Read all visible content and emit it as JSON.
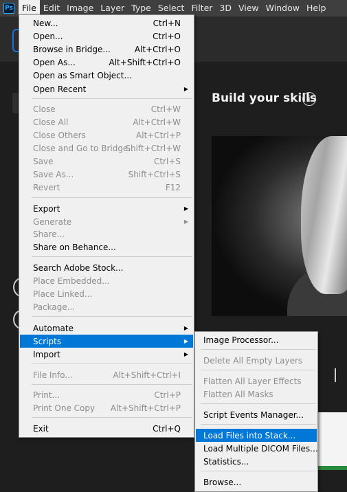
{
  "menubar": {
    "logo": "Ps",
    "items": [
      "File",
      "Edit",
      "Image",
      "Layer",
      "Type",
      "Select",
      "Filter",
      "3D",
      "View",
      "Window",
      "Help"
    ],
    "active": "File"
  },
  "background": {
    "heading": "Build your skills",
    "info_icon": "i"
  },
  "file_menu": [
    {
      "label": "New...",
      "shortcut": "Ctrl+N"
    },
    {
      "label": "Open...",
      "shortcut": "Ctrl+O"
    },
    {
      "label": "Browse in Bridge...",
      "shortcut": "Alt+Ctrl+O"
    },
    {
      "label": "Open As...",
      "shortcut": "Alt+Shift+Ctrl+O"
    },
    {
      "label": "Open as Smart Object...",
      "shortcut": ""
    },
    {
      "label": "Open Recent",
      "shortcut": "",
      "submenu": true
    },
    {
      "label": "Close",
      "shortcut": "Ctrl+W",
      "disabled": true
    },
    {
      "label": "Close All",
      "shortcut": "Alt+Ctrl+W",
      "disabled": true
    },
    {
      "label": "Close Others",
      "shortcut": "Alt+Ctrl+P",
      "disabled": true
    },
    {
      "label": "Close and Go to Bridge...",
      "shortcut": "Shift+Ctrl+W",
      "disabled": true
    },
    {
      "label": "Save",
      "shortcut": "Ctrl+S",
      "disabled": true
    },
    {
      "label": "Save As...",
      "shortcut": "Shift+Ctrl+S",
      "disabled": true
    },
    {
      "label": "Revert",
      "shortcut": "F12",
      "disabled": true
    },
    {
      "label": "Export",
      "shortcut": "",
      "submenu": true
    },
    {
      "label": "Generate",
      "shortcut": "",
      "submenu": true,
      "disabled": true
    },
    {
      "label": "Share...",
      "shortcut": "",
      "disabled": true
    },
    {
      "label": "Share on Behance...",
      "shortcut": ""
    },
    {
      "label": "Search Adobe Stock...",
      "shortcut": ""
    },
    {
      "label": "Place Embedded...",
      "shortcut": "",
      "disabled": true
    },
    {
      "label": "Place Linked...",
      "shortcut": "",
      "disabled": true
    },
    {
      "label": "Package...",
      "shortcut": "",
      "disabled": true
    },
    {
      "label": "Automate",
      "shortcut": "",
      "submenu": true
    },
    {
      "label": "Scripts",
      "shortcut": "",
      "submenu": true,
      "highlighted": true
    },
    {
      "label": "Import",
      "shortcut": "",
      "submenu": true
    },
    {
      "label": "File Info...",
      "shortcut": "Alt+Shift+Ctrl+I",
      "disabled": true
    },
    {
      "label": "Print...",
      "shortcut": "Ctrl+P",
      "disabled": true
    },
    {
      "label": "Print One Copy",
      "shortcut": "Alt+Shift+Ctrl+P",
      "disabled": true
    },
    {
      "label": "Exit",
      "shortcut": "Ctrl+Q"
    }
  ],
  "scripts_menu": [
    {
      "label": "Image Processor..."
    },
    {
      "label": "Delete All Empty Layers",
      "disabled": true
    },
    {
      "label": "Flatten All Layer Effects",
      "disabled": true
    },
    {
      "label": "Flatten All Masks",
      "disabled": true
    },
    {
      "label": "Script Events Manager..."
    },
    {
      "label": "Load Files into Stack...",
      "highlighted": true
    },
    {
      "label": "Load Multiple DICOM Files..."
    },
    {
      "label": "Statistics..."
    },
    {
      "label": "Browse..."
    }
  ],
  "icons": {
    "submenu_arrow": "▶",
    "app_logo": "photoshop-logo-icon"
  },
  "colors": {
    "highlight": "#0078d7",
    "accent": "#1473e6",
    "menubar": "#3f3f3f"
  }
}
